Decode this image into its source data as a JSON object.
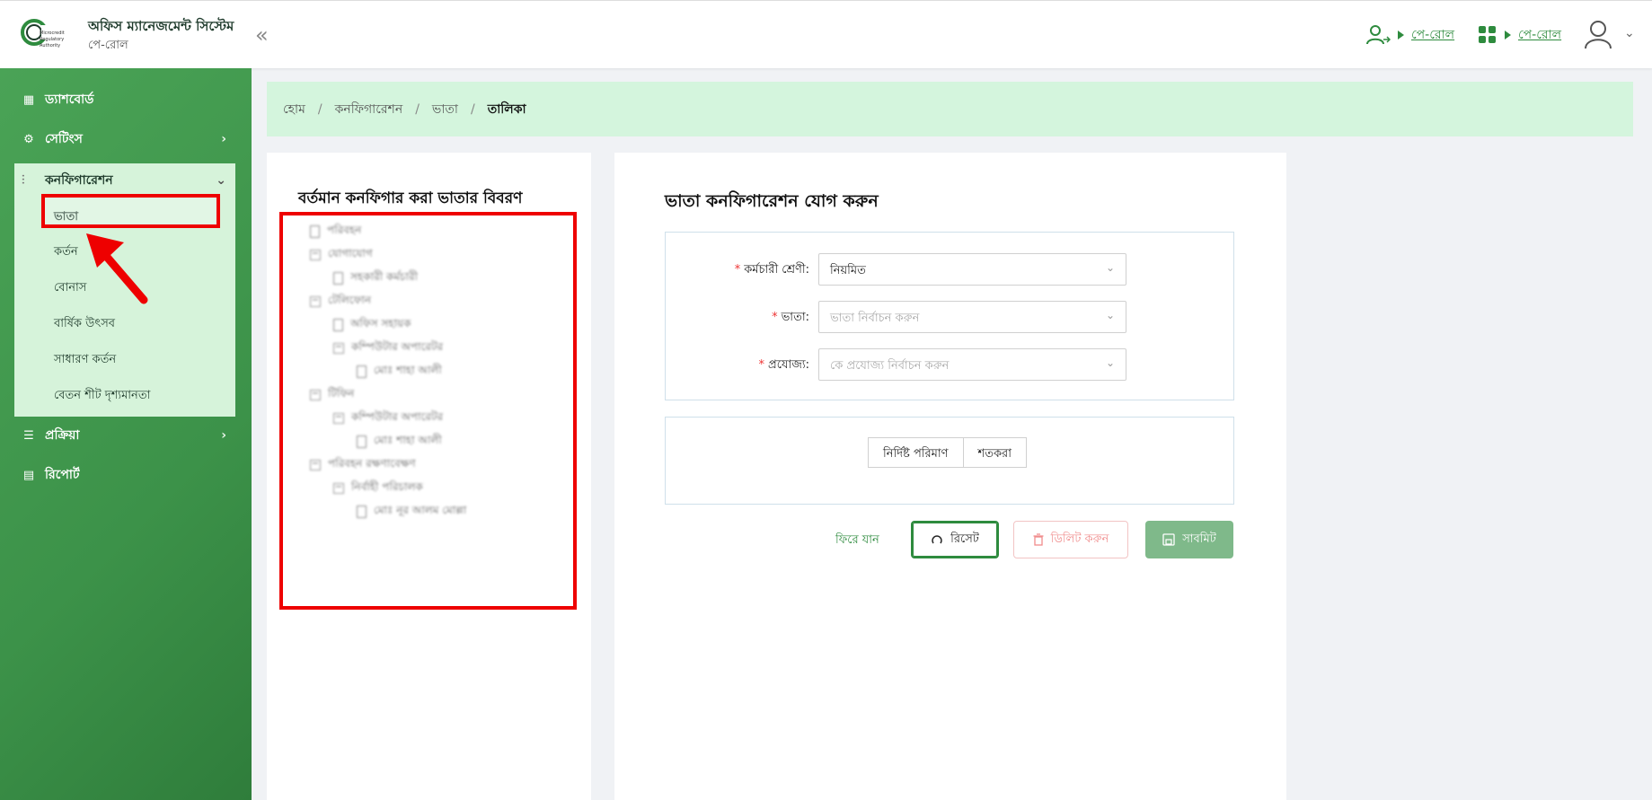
{
  "header": {
    "app_title": "অফিস ম্যানেজমেন্ট সিস্টেম",
    "app_subtitle": "পে-রোল",
    "logo_text": "Microcredit Regulatory Authority",
    "collapse_icon": "double-chevron-left-icon",
    "links": [
      {
        "icon": "user-switch-icon",
        "label": "পে-রোল"
      },
      {
        "icon": "apps-grid-icon",
        "label": "পে-রোল"
      }
    ],
    "user_icon": "user-icon"
  },
  "sidebar": {
    "items": [
      {
        "label": "ড্যাশবোর্ড",
        "icon": "dashboard-icon"
      },
      {
        "label": "সেটিংস",
        "icon": "gear-icon"
      },
      {
        "label": "কনফিগারেশন",
        "icon": "sliders-icon"
      },
      {
        "label": "প্রক্রিয়া",
        "icon": "tune-icon"
      },
      {
        "label": "রিপোর্ট",
        "icon": "document-icon"
      }
    ],
    "config_sub": [
      "ভাতা",
      "কর্তন",
      "বোনাস",
      "বার্ষিক উৎসব",
      "সাধারণ কর্তন",
      "বেতন শীট দৃশ্যমানতা"
    ],
    "accent": "#4aa356"
  },
  "breadcrumb": {
    "items": [
      "হোম",
      "কনফিগারেশন",
      "ভাতা"
    ],
    "current": "তালিকা"
  },
  "left_panel": {
    "title": "বর্তমান কনফিগার করা ভাতার বিবরণ",
    "tree": [
      {
        "label": "পরিবহন",
        "type": "file",
        "level": 0
      },
      {
        "label": "যোগাযোগ",
        "type": "folder",
        "level": 0
      },
      {
        "label": "সহকারী কর্মচারী",
        "type": "file",
        "level": 1
      },
      {
        "label": "টেলিফোন",
        "type": "folder",
        "level": 0
      },
      {
        "label": "অফিস সহায়ক",
        "type": "file",
        "level": 1
      },
      {
        "label": "কম্পিউটার অপারেটর",
        "type": "folder",
        "level": 1
      },
      {
        "label": "মোঃ শাহা আলী",
        "type": "file",
        "level": 2
      },
      {
        "label": "টিফিন",
        "type": "folder",
        "level": 0
      },
      {
        "label": "কম্পিউটার অপারেটর",
        "type": "folder",
        "level": 1
      },
      {
        "label": "মোঃ শাহা আলী",
        "type": "file",
        "level": 2
      },
      {
        "label": "পরিবহন রক্ষণাবেক্ষণ",
        "type": "folder",
        "level": 0
      },
      {
        "label": "নির্বাহী পরিচালক",
        "type": "folder",
        "level": 1
      },
      {
        "label": "মোঃ নূর আলম মোল্লা",
        "type": "file",
        "level": 2
      }
    ]
  },
  "form": {
    "title": "ভাতা কনফিগারেশন যোগ করুন",
    "fields": [
      {
        "label": "কর্মচারী শ্রেণী:",
        "value": "নিয়মিত",
        "placeholder": ""
      },
      {
        "label": "ভাতা:",
        "value": "",
        "placeholder": "ভাতা নির্বাচন করুন"
      },
      {
        "label": "প্রযোজ্য:",
        "value": "",
        "placeholder": "কে প্রযোজ্য নির্বাচন করুন"
      }
    ],
    "toggle": [
      "নির্দিষ্ট পরিমাণ",
      "শতকরা"
    ],
    "actions": {
      "back": "ফিরে যান",
      "reset": "রিসেট",
      "delete": "ডিলিট করুন",
      "submit": "সাবমিট"
    }
  }
}
